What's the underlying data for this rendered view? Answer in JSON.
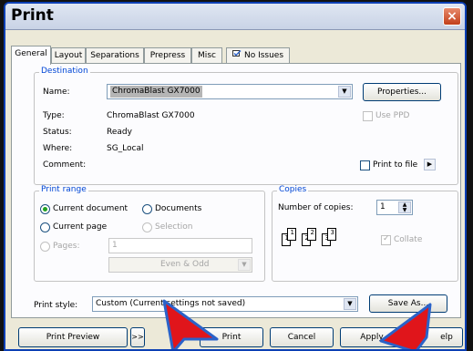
{
  "window": {
    "title": "Print",
    "close_icon": "×"
  },
  "tabs": [
    "General",
    "Layout",
    "Separations",
    "Prepress",
    "Misc",
    "No Issues"
  ],
  "destination": {
    "legend": "Destination",
    "name_label": "Name:",
    "name_value": "ChromaBlast GX7000",
    "properties_button": "Properties...",
    "type_label": "Type:",
    "type_value": "ChromaBlast GX7000",
    "status_label": "Status:",
    "status_value": "Ready",
    "where_label": "Where:",
    "where_value": "SG_Local",
    "comment_label": "Comment:",
    "use_ppd_label": "Use PPD",
    "print_to_file_label": "Print to file"
  },
  "print_range": {
    "legend": "Print range",
    "current_document": "Current document",
    "documents": "Documents",
    "current_page": "Current page",
    "selection": "Selection",
    "pages_label": "Pages:",
    "pages_value": "1",
    "page_set": "Even & Odd"
  },
  "copies": {
    "legend": "Copies",
    "number_label": "Number of copies:",
    "number_value": "1",
    "collate_label": "Collate",
    "page_icons": [
      "1",
      "1",
      "2",
      "2",
      "3",
      "3"
    ]
  },
  "print_style": {
    "label": "Print style:",
    "value": "Custom (Current settings not saved)",
    "save_as_button": "Save As..."
  },
  "footer": {
    "print_preview": "Print Preview",
    "preview_toggle": ">>",
    "print": "Print",
    "cancel": "Cancel",
    "apply": "Apply",
    "help": "elp"
  },
  "colors": {
    "accent": "#0046d5",
    "arrow": "#e0151b",
    "arrow_outline": "#2a62c9"
  }
}
